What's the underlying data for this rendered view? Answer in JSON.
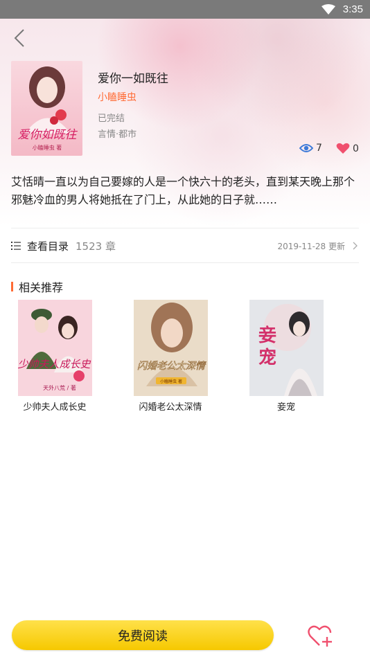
{
  "status_bar": {
    "time": "3:35"
  },
  "book": {
    "title": "爱你一如既往",
    "author": "小瞌睡虫",
    "status": "已完结",
    "genre": "言情·都市",
    "cover_text": "爱你如既往",
    "cover_author": "小瞌睡虫 著",
    "views": "7",
    "likes": "0",
    "synopsis": "艾恬晴一直以为自己要嫁的人是一个快六十的老头，直到某天晚上那个邪魅冷血的男人将她抵在了门上，从此她的日子就……"
  },
  "catalog": {
    "label": "查看目录",
    "count": "1523 章",
    "updated": "2019-11-28 更新"
  },
  "recommendations": {
    "title": "相关推荐",
    "items": [
      {
        "title": "少帅夫人成长史",
        "cover_text": "少帅夫人成长史",
        "cover_author": "天外八荒 / 著"
      },
      {
        "title": "闪婚老公太深情",
        "cover_text": "闪婚老公太深情",
        "cover_author": "小瞌睡虫 著"
      },
      {
        "title": "妾宠",
        "cover_text": "妾宠",
        "cover_author": ""
      }
    ]
  },
  "bottom": {
    "read_label": "免费阅读"
  },
  "colors": {
    "accent": "#ff6b35",
    "read_button": "#f6c800",
    "heart": "#f0506e",
    "eye": "#3d7ad8"
  },
  "icons": [
    "back-arrow-icon",
    "eye-icon",
    "heart-icon",
    "list-icon",
    "chevron-right-icon",
    "heart-plus-icon",
    "wifi-icon"
  ]
}
